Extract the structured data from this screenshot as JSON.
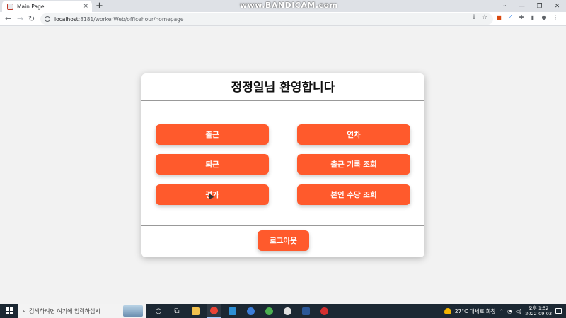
{
  "browser": {
    "tab_title": "Main Page",
    "tab_close": "×",
    "new_tab": "+",
    "watermark": "www.BANDICAM.com",
    "url_host": "localhost",
    "url_rest": ":8181/workerWeb/officehour/homepage",
    "nav": {
      "back": "←",
      "forward": "→",
      "reload": "↻"
    },
    "window_controls": {
      "dropdown": "⌄",
      "minimize": "—",
      "maximize": "❐",
      "close": "✕"
    }
  },
  "page": {
    "title": "정정일님 환영합니다",
    "buttons": {
      "clock_in": "출근",
      "annual_leave": "연차",
      "clock_out": "퇴근",
      "attendance_history": "출근 기록 조회",
      "evaluation": "평가",
      "my_allowance": "본인 수당 조회",
      "logout": "로그아웃"
    },
    "accent_color": "#ff5a2c"
  },
  "taskbar": {
    "search_placeholder": "검색하려면 여기에 입력하십시",
    "weather": "27°C  대체로 화창",
    "time": "오후 1:52",
    "date": "2022-09-03"
  }
}
